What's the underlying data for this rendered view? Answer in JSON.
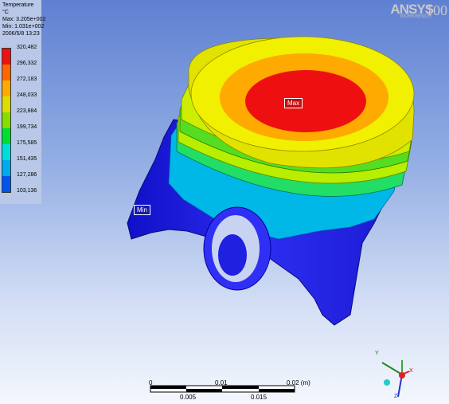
{
  "legend": {
    "title": "Temperature",
    "unit": "°C",
    "max": "Max: 3.205e+002",
    "min": "Min: 1.031e+002",
    "date": "2006/5/8 13:23",
    "ticks": [
      "320,482",
      "296,332",
      "272,183",
      "248,033",
      "223,884",
      "199,734",
      "175,585",
      "151,435",
      "127,286",
      "103,136"
    ],
    "colors": [
      "#ee1111",
      "#ff6600",
      "#ffaa00",
      "#dddd00",
      "#88dd00",
      "#00dd33",
      "#00dddd",
      "#00aaee",
      "#0055ee",
      "#0000dd"
    ]
  },
  "logo": {
    "brand": "ANSYS",
    "product": "WORKBENCH",
    "version": "100"
  },
  "probes": {
    "max_label": "Max",
    "min_label": "Min"
  },
  "scale_bar": {
    "top_labels": [
      "0",
      "0.01",
      "0.02 (m)"
    ],
    "bottom_labels": [
      "0.005",
      "0.015"
    ]
  },
  "triad": {
    "x": "X",
    "y": "Y",
    "z": "Z"
  }
}
